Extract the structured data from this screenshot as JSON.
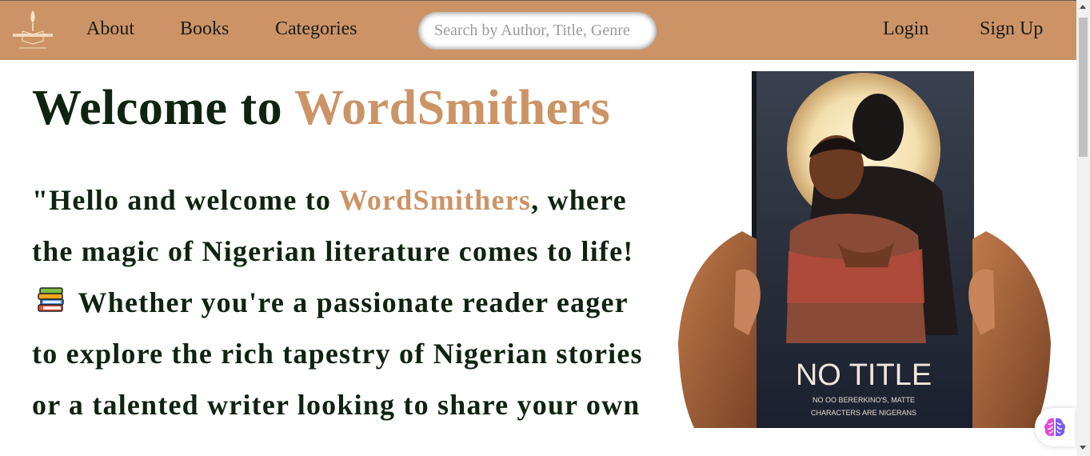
{
  "nav": {
    "logo_text": "WORDSMITHERS",
    "links": [
      "About",
      "Books",
      "Categories"
    ],
    "search_placeholder": "Search by Author, Title, Genre",
    "login_label": "Login",
    "signup_label": "Sign Up"
  },
  "hero": {
    "title_prefix": "Welcome to ",
    "title_brand": "WordSmithers",
    "intro_part1": "\"Hello and welcome to ",
    "intro_brand": "WordSmithers",
    "intro_part2": ", where the magic of Nigerian literature comes to life! ",
    "intro_part3": " Whether you're a passionate reader eager to explore the rich tapestry of Nigerian stories or a talented writer looking to share your own"
  },
  "book_cover": {
    "title": "NO TITLE",
    "subtitle_line1": "NO OO BERERKINO'S, MATTE",
    "subtitle_line2": "CHARACTERS ARE NIGERANS"
  },
  "colors": {
    "nav_bg": "#cc9466",
    "accent": "#cc9466",
    "text_dark": "#0f2410"
  },
  "icons": {
    "books": "books-emoji-icon",
    "assistant": "brain-assistant-icon"
  }
}
